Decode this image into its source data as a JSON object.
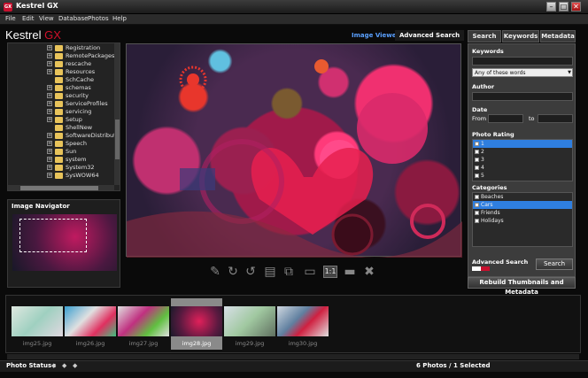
{
  "window": {
    "title": "Kestrel GX",
    "icon_text": "GX",
    "controls": [
      "–",
      "□",
      "✕"
    ]
  },
  "menu": [
    "File",
    "Edit",
    "View",
    "Database",
    "Photos",
    "Help"
  ],
  "brand": {
    "word": "Kestrel",
    "accent": "GX",
    "accent_color": "#d0102a"
  },
  "viewer_tabs": {
    "image_viewer": "Image Viewer",
    "advanced_search": "Advanced Search"
  },
  "tree": {
    "items": [
      {
        "label": "Registration",
        "expander": "+"
      },
      {
        "label": "RemotePackages",
        "expander": "+"
      },
      {
        "label": "rescache",
        "expander": "+"
      },
      {
        "label": "Resources",
        "expander": "+"
      },
      {
        "label": "SchCache",
        "expander": ""
      },
      {
        "label": "schemas",
        "expander": "+"
      },
      {
        "label": "security",
        "expander": "+"
      },
      {
        "label": "ServiceProfiles",
        "expander": "+"
      },
      {
        "label": "servicing",
        "expander": "+"
      },
      {
        "label": "Setup",
        "expander": "+"
      },
      {
        "label": "ShellNew",
        "expander": ""
      },
      {
        "label": "SoftwareDistributio",
        "expander": "+"
      },
      {
        "label": "Speech",
        "expander": "+"
      },
      {
        "label": "Sun",
        "expander": "+"
      },
      {
        "label": "system",
        "expander": "+"
      },
      {
        "label": "System32",
        "expander": "+"
      },
      {
        "label": "SysWOW64",
        "expander": "+"
      }
    ]
  },
  "navigator": {
    "title": "Image Navigator"
  },
  "toolbar": {
    "tools": [
      "brush-icon",
      "rotate-right-icon",
      "rotate-left-icon",
      "film-icon",
      "crop-icon",
      "monitor-icon",
      "actual-size-icon",
      "fit-screen-icon",
      "delete-icon"
    ],
    "actual_size_label": "1:1"
  },
  "right_panel": {
    "tabs": [
      "Search",
      "Keywords",
      "Metadata"
    ],
    "keywords_label": "Keywords",
    "keywords_value": "",
    "match_mode": "Any of these words",
    "author_label": "Author",
    "date_label": "Date",
    "date_from_label": "From",
    "date_to_label": "to",
    "rating_label": "Photo Rating",
    "ratings": [
      "1",
      "2",
      "3",
      "4",
      "5"
    ],
    "categories_label": "Categories",
    "categories": [
      "Beaches",
      "Cars",
      "Friends",
      "Holidays"
    ],
    "advanced_search_label": "Advanced Search",
    "search_button": "Search",
    "rebuild_button": "Rebuild Thumbnails and Metadata"
  },
  "filmstrip": {
    "photos": [
      {
        "name": "img25.jpg"
      },
      {
        "name": "img26.jpg"
      },
      {
        "name": "img27.jpg"
      },
      {
        "name": "img28.jpg",
        "selected": true
      },
      {
        "name": "img29.jpg"
      },
      {
        "name": "img30.jpg"
      }
    ]
  },
  "status": {
    "label": "Photo Status :",
    "count": "6 Photos / 1 Selected"
  }
}
